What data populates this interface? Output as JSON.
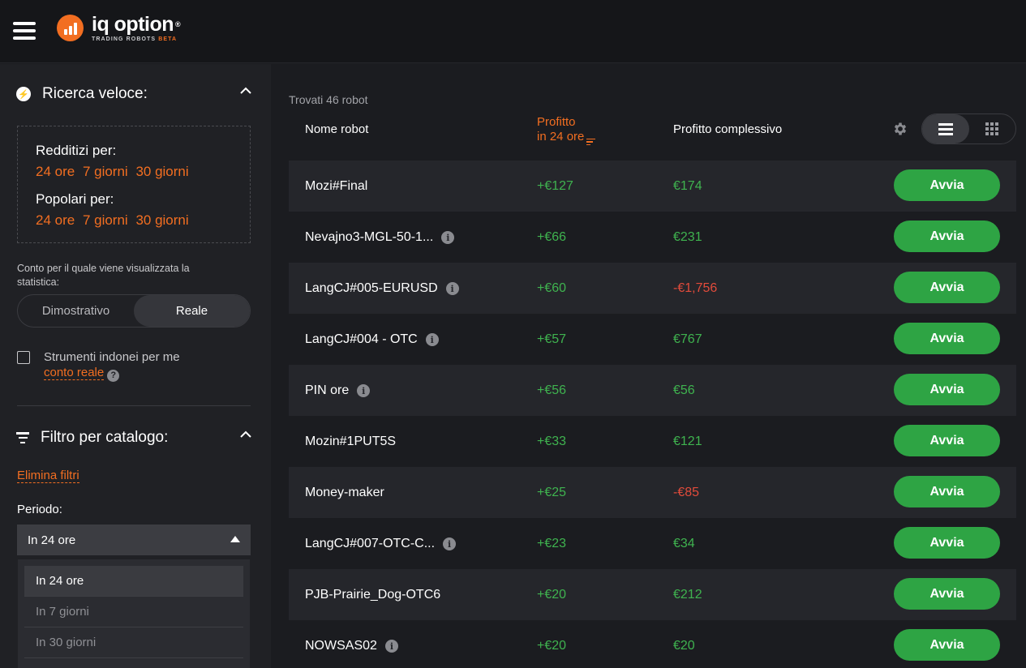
{
  "brand": {
    "name": "iq option",
    "registered": "®",
    "tagline": "TRADING ROBOTS",
    "beta": "BETA",
    "color": "#f26e21"
  },
  "sidebar": {
    "quick_search": {
      "title": "Ricerca veloce:",
      "profitable_label": "Redditizi per:",
      "profitable_links": [
        "24 ore",
        "7 giorni",
        "30 giorni"
      ],
      "popular_label": "Popolari per:",
      "popular_links": [
        "24 ore",
        "7 giorni",
        "30 giorni"
      ]
    },
    "account_label": "Conto per il quale viene visualizzata la statistica:",
    "account_toggle": {
      "options": [
        "Dimostrativo",
        "Reale"
      ],
      "selected": "Reale"
    },
    "suitable": {
      "text": "Strumenti indonei per me",
      "link": "conto reale",
      "help": "?"
    },
    "catalog_filter": {
      "title": "Filtro per catalogo:",
      "clear": "Elimina filtri",
      "period_label": "Periodo:",
      "period_value": "In 24 ore",
      "period_options": [
        "In 24 ore",
        "In 7 giorni",
        "In 30 giorni"
      ]
    }
  },
  "main": {
    "found": "Trovati 46 robot",
    "columns": {
      "name": "Nome robot",
      "profit24_line1": "Profitto",
      "profit24_line2": "in 24 ore",
      "total": "Profitto complessivo"
    },
    "start_label": "Avvia",
    "rows": [
      {
        "name": "Mozi#Final",
        "info": false,
        "p24": "+€127",
        "total": "€174",
        "neg": false
      },
      {
        "name": "Nevajno3-MGL-50-1...",
        "info": true,
        "p24": "+€66",
        "total": "€231",
        "neg": false
      },
      {
        "name": "LangCJ#005-EURUSD",
        "info": true,
        "p24": "+€60",
        "total": "-€1,756",
        "neg": true
      },
      {
        "name": "LangCJ#004 - OTC",
        "info": true,
        "p24": "+€57",
        "total": "€767",
        "neg": false
      },
      {
        "name": "PIN ore",
        "info": true,
        "p24": "+€56",
        "total": "€56",
        "neg": false
      },
      {
        "name": "Mozin#1PUT5S",
        "info": false,
        "p24": "+€33",
        "total": "€121",
        "neg": false
      },
      {
        "name": "Money-maker",
        "info": false,
        "p24": "+€25",
        "total": "-€85",
        "neg": true
      },
      {
        "name": "LangCJ#007-OTC-C...",
        "info": true,
        "p24": "+€23",
        "total": "€34",
        "neg": false
      },
      {
        "name": "PJB-Prairie_Dog-OTC6",
        "info": false,
        "p24": "+€20",
        "total": "€212",
        "neg": false
      },
      {
        "name": "NOWSAS02",
        "info": true,
        "p24": "+€20",
        "total": "€20",
        "neg": false
      }
    ]
  }
}
